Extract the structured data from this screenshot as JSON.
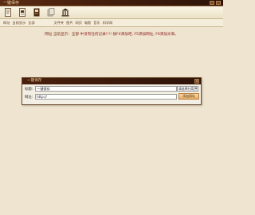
{
  "window": {
    "title": "一键保存"
  },
  "toolbar": {
    "icons": [
      "document-icon",
      "document-icon",
      "book-icon",
      "copy-icon",
      "bank-icon"
    ]
  },
  "nav": {
    "group1": [
      "网址",
      "当前显示",
      "全部"
    ],
    "group2": [
      "文件夹",
      "图片",
      "网页",
      "电影",
      "音乐",
      "科学网"
    ]
  },
  "status": {
    "label": "网址 当前显示：全部",
    "message": "中没有任何记录!!!! 按F4添加吧, F5添加网址, F6添加文章。"
  },
  "dialog": {
    "title": "一键保存",
    "title_label": "标题:",
    "title_value": "一键保存",
    "category_value": "请选择分类",
    "url_label": "网址:",
    "url_value": "http://",
    "add_button": "添加网址",
    "close_label": "×"
  }
}
